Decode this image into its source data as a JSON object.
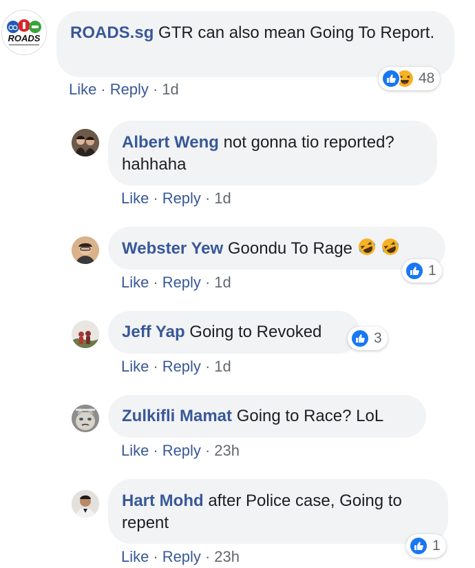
{
  "comments": [
    {
      "author": "ROADS.sg",
      "text": "GTR can also mean Going To Report.",
      "actions": {
        "like": "Like",
        "reply": "Reply",
        "time": "1d"
      },
      "reactions": {
        "count": "48",
        "types": [
          "like-icon",
          "haha-icon"
        ]
      },
      "logo_text": "ROADS"
    },
    {
      "author": "Albert Weng",
      "text": "not gonna tio reported? hahhaha",
      "actions": {
        "like": "Like",
        "reply": "Reply",
        "time": "1d"
      }
    },
    {
      "author": "Webster Yew",
      "text": "Goondu To Rage",
      "emojis": [
        "rofl-emoji",
        "rofl-emoji"
      ],
      "actions": {
        "like": "Like",
        "reply": "Reply",
        "time": "1d"
      },
      "reactions": {
        "count": "1",
        "types": [
          "like-icon"
        ]
      }
    },
    {
      "author": "Jeff Yap",
      "text": "Going to Revoked",
      "actions": {
        "like": "Like",
        "reply": "Reply",
        "time": "1d"
      },
      "reactions": {
        "count": "3",
        "types": [
          "like-icon"
        ]
      }
    },
    {
      "author": "Zulkifli Mamat",
      "text": "Going to Race? LoL",
      "actions": {
        "like": "Like",
        "reply": "Reply",
        "time": "23h"
      }
    },
    {
      "author": "Hart Mohd",
      "text": "after Police case, Going to repent",
      "actions": {
        "like": "Like",
        "reply": "Reply",
        "time": "23h"
      },
      "reactions": {
        "count": "1",
        "types": [
          "like-icon"
        ]
      }
    }
  ],
  "colors": {
    "link": "#385898",
    "bubble": "#f2f3f5",
    "like": "#1877f2",
    "haha": "#f7b125",
    "meta": "#606770"
  }
}
